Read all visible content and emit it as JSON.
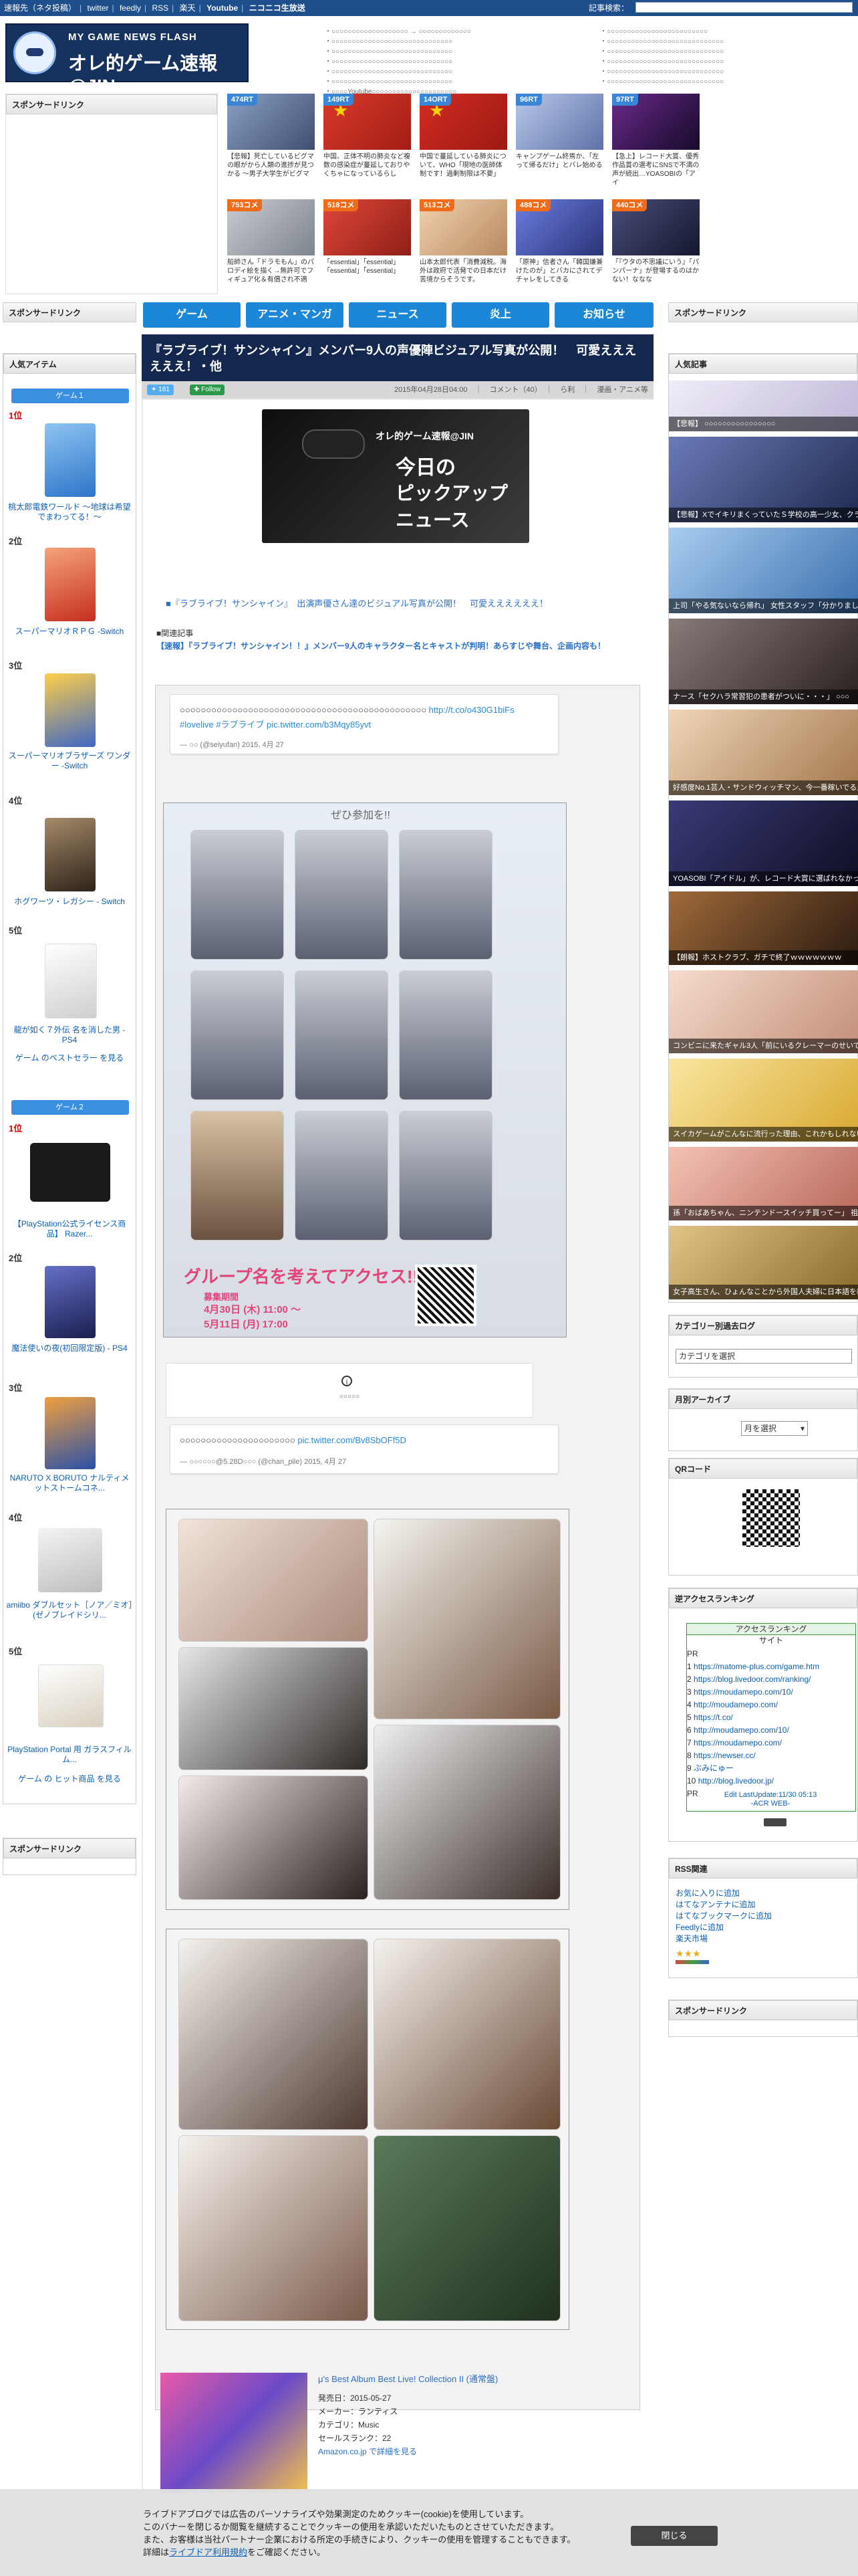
{
  "topbar": {
    "links": [
      "速報先（ネタ投稿）",
      "twitter",
      "feedly",
      "RSS",
      "楽天",
      "Youtube",
      "ニコニコ生放送"
    ],
    "search_label": "記事検索：",
    "search_placeholder": ""
  },
  "header": {
    "logo_subtitle": "MY GAME NEWS FLASH",
    "logo_title": "オレ的ゲーム速報@JIN",
    "links_col1": [
      "・○○○○○○○○○○○○○○○○○○○ → ○○○○○○○○○○○○○",
      "・○○○○○○○○○○○○○○○○○○○○○○○○○○○○○○",
      "・○○○○○○○○○○○○○○○○○○○○○○○○○○○○○○",
      "・○○○○○○○○○○○○○○○○○○○○○○○○○○○○○○",
      "・○○○○○○○○○○○○○○○○○○○○○○○○○○○○○○",
      "・○○○○○○○○○○○○○○○○○○○○○○○○○○○○○○",
      "・○○○○Youtube○○○○○○○○○○○○○○○○○○○○○"
    ],
    "links_col2": [
      "・○○○○○○○○○○○○○○○○○○○○○○○○○",
      "・○○○○○○○○○○○○○○○○○○○○○○○○○○○○○",
      "・○○○○○○○○○○○○○○○○○○○○○○○○○○○○○",
      "・○○○○○○○○○○○○○○○○○○○○○○○○○○○○○",
      "・○○○○○○○○○○○○○○○○○○○○○○○○○○○○○",
      "・○○○○○○○○○○○○○○○○○○○○○○○○○○○○○"
    ]
  },
  "sponsored_label": "スポンサードリンク",
  "thumbs": [
    {
      "badge": "474RT",
      "badge_type": "blue",
      "caption": "【悲報】死亡しているビグマの眼がから人類の進捗が見つかる ～男子大学生がビグマ",
      "color": "#5a6d8e"
    },
    {
      "badge": "149RT",
      "badge_type": "blue",
      "caption": "中国、正体不明の肺炎など複数の感染症が蔓延しておりやくちゃになっているらし",
      "color": "#c42a1f"
    },
    {
      "badge": "14ORT",
      "badge_type": "blue",
      "caption": "中国で蔓延している肺炎について、WHO「現地の医師体制です！過剰制限は不要」",
      "color": "#b8241c"
    },
    {
      "badge": "96RT",
      "badge_type": "blue",
      "caption": "キャンプゲーム終焉か、「左って帰るだけ」とバレ始める",
      "color": "#7d8fb8"
    },
    {
      "badge": "97RT",
      "badge_type": "blue",
      "caption": "【急上】レコード大賞、優秀作品賞の選考にSNSで不満の声が続出…YOASOBIの「アイ",
      "color": "#2a1640"
    },
    {
      "badge": "753コメ",
      "badge_type": "orange",
      "caption": "船師さん「ドラモもん」のパロディ絵を描く→無許可でフィギュア化＆有償され不適",
      "color": "#9aa0a8"
    },
    {
      "badge": "518コメ",
      "badge_type": "orange",
      "caption": "「essential」「essential」「essential」「essential」",
      "color": "#c23328"
    },
    {
      "badge": "513コメ",
      "badge_type": "orange",
      "caption": "山本太郎代表「消費減税。海外は政府で活発での日本だけ苦境からそうです。",
      "color": "#d8b38a"
    },
    {
      "badge": "488コメ",
      "badge_type": "orange",
      "caption": "「原神」信者さん「韓国嫌兼けたのが」とバカにされてデチャレをしてきる",
      "color": "#3a4b9e"
    },
    {
      "badge": "440コメ",
      "badge_type": "orange",
      "caption": "「『ウタの不思議にいう』「パンパーナ」が登場するのはかない！ななな",
      "color": "#2b2d4e"
    }
  ],
  "nav": [
    "ゲーム",
    "アニメ・マンガ",
    "ニュース",
    "炎上",
    "お知らせ"
  ],
  "left_sidebar": {
    "popular_title": "人気アイテム",
    "game_tab1": "ゲーム１",
    "rank_list1": [
      {
        "rank": "1位",
        "name": "桃太郎電鉄ワールド ～地球は希望でまわってる！～",
        "red": true,
        "color": "#3e8ed8"
      },
      {
        "rank": "2位",
        "name": "スーパーマリオＲＰＧ -Switch",
        "red": false,
        "color": "#d6483b"
      },
      {
        "rank": "3位",
        "name": "スーパーマリオブラザーズ ワンダー -Switch",
        "red": false,
        "color": "#4b6fbf"
      },
      {
        "rank": "4位",
        "name": "ホグワーツ・レガシー - Switch",
        "red": false,
        "color": "#4d3b2a"
      },
      {
        "rank": "5位",
        "name": "龍が如く７外伝 名を消した男 - PS4",
        "red": false,
        "color": "#f3f3f3"
      }
    ],
    "best_link1": "ゲーム のベストセラー を見る",
    "game_tab2": "ゲーム２",
    "rank_list2": [
      {
        "rank": "1位",
        "name": "【PlayStation公式ライセンス商品】 Razer...",
        "red": true,
        "color": "#1a1a1a"
      },
      {
        "rank": "2位",
        "name": "魔法使いの夜(初回限定版) - PS4",
        "red": false,
        "color": "#2f3a7a"
      },
      {
        "rank": "3位",
        "name": "NARUTO X BORUTO ナルティメットストームコネ...",
        "red": false,
        "color": "#d5682c"
      },
      {
        "rank": "4位",
        "name": "amiibo ダブルセット［ノア／ミオ］(ゼノブレイドシリ...",
        "red": false,
        "color": "#d7d7d7"
      },
      {
        "rank": "5位",
        "name": "PlayStation Portal 用 ガラスフィルム...",
        "red": false,
        "color": "#f0f0f0"
      }
    ],
    "best_link2": "ゲーム の ヒット商品 を見る",
    "sponsor_bottom": "スポンサードリンク"
  },
  "article": {
    "title": "『ラブライブ！サンシャイン』メンバー9人の声優陣ビジュアル写真が公開！　可愛ええええええ！・他",
    "tweet_count": "181",
    "follow_label": "Follow",
    "meta": "2015年04月28日04:00　｜　コメント（40）　｜　ら利　｜　漫画・アニメ等",
    "banner_line1": "オレ的ゲーム速報@JIN",
    "banner_line2": "今日の",
    "banner_line3": "ピックアップ",
    "banner_line4": "ニュース",
    "headline_link": "■『ラブライブ！サンシャイン』　出演声優さん達のビジュアル写真が公開！　可愛ええええええ！",
    "related_label": "■関連記事",
    "related_link": "【速報】『ラブライブ！サンシャイン！！』メンバー9人のキャラクター名とキャストが判明！あらすじや舞台、企画内容も！",
    "tweet1_text": "○○○○○○○○○○○○○○○○○○○○○○○○○○○○○○○○○○○○○○○○○○○○○○○",
    "tweet1_link": "http://t.co/o430G1biFs #lovelive #ラブライブ pic.twitter.com/b3Mqy85yvt",
    "tweet1_meta": "— ○○ (@seiyufan) 2015, 4月 27",
    "poster_caption": "グループ名を考えてアクセス!!",
    "poster_sub1": "募集期間",
    "poster_sub2": "4月30日 (木) 11:00 ～",
    "poster_sub3": "5月11日 (月) 17:00",
    "poster_header": "ぜひ参加を!!",
    "media_unavailable": "○○○○○",
    "tweet2_text": "○○○○○○○○○○○○○○○○○○○○○○",
    "tweet2_link": "pic.twitter.com/Bv8SbOFf5D",
    "tweet2_meta": "— ○○○○○○@5.28D○○○ (@chan_pile) 2015, 4月 27",
    "album_title": "μ's Best Album Best Live! Collection II (通常盤)",
    "album_release": "発売日：2015-05-27",
    "album_maker": "メーカー：ランティス",
    "album_category": "カテゴリ：Music",
    "album_rank": "セールスランク：22",
    "album_link": "Amazon.co.jp で詳細を見る"
  },
  "right_sidebar": {
    "sponsor1": "スポンサードリンク",
    "popular_title": "人気記事",
    "popular": [
      {
        "caption": "【悲報】 ○○○○○○○○○○○○○○○○",
        "color": "#e8e4f2"
      },
      {
        "caption": "【悲報】XでイキリまくっていたＳ学校の高一少女、クラスLINEにツイートを晒されて厳しい状態に",
        "color": "#3f4c7e"
      },
      {
        "caption": "上司「やる気ないなら帰れ」 女性スタッフ「分かりました、辞めます」→ 結果ｗｗｗｗｗｗ",
        "color": "#7aa6d3"
      },
      {
        "caption": "ナース「セクハラ常習犯の患者がついに・・・」 ○○○",
        "color": "#4a3e3a"
      },
      {
        "caption": "好感度No.1芸人・サンドウィッチマン、今一番稼いでる人ばかりまくりの素をした",
        "color": "#c9a07c"
      },
      {
        "caption": "YOASOBI「アイドル」が、レコード大賞に選ばれなかった理由、これかもしれない",
        "color": "#1c1c3a"
      },
      {
        "caption": "【朗報】ホストクラブ、ガチで終了ｗｗｗｗｗｗｗ",
        "color": "#5a3a2a"
      },
      {
        "caption": "コンビニに来たギャル3人「前にいるクレーマーのせいで入らざる」ちょうどそこに…",
        "color": "#e2b9a4"
      },
      {
        "caption": "スイカゲームがこんなに流行った理由、これかもしれない",
        "color": "#f2d35a"
      },
      {
        "caption": "孫「おばあちゃん、ニンテンドースイッチ買ってー」 祖母「いいよ」 → 結果",
        "color": "#e09a8a"
      },
      {
        "caption": "女子高生さん、ひょんなことから外国人夫婦に日本語を教える事になってしまった結果",
        "color": "#b5944c"
      }
    ],
    "category_title": "カテゴリー別過去ログ",
    "category_select": "カテゴリを選択",
    "archive_title": "月別アーカイブ",
    "archive_select": "月を選択",
    "qr_title": "QRコード",
    "access_title": "逆アクセスランキング",
    "access_header": "アクセスランキング",
    "access_col": "サイト",
    "access_rows": [
      {
        "n": "PR",
        "site": ""
      },
      {
        "n": "1",
        "site": "https://matome-plus.com/game.htm"
      },
      {
        "n": "2",
        "site": "https://blog.livedoor.com/ranking/"
      },
      {
        "n": "3",
        "site": "https://moudamepo.com/10/"
      },
      {
        "n": "4",
        "site": "http://moudamepo.com/"
      },
      {
        "n": "5",
        "site": "https://t.co/"
      },
      {
        "n": "6",
        "site": "http://moudamepo.com/10/"
      },
      {
        "n": "7",
        "site": "https://moudamepo.com/"
      },
      {
        "n": "8",
        "site": "https://newser.cc/"
      },
      {
        "n": "9",
        "site": "ぶみにゅー"
      },
      {
        "n": "10",
        "site": "http://blog.livedoor.jp/"
      },
      {
        "n": "PR",
        "site": ""
      }
    ],
    "access_footer": "Edit LastUpdate:11/30 05:13",
    "access_footer2": "-ACR WEB-",
    "rss_title": "RSS関連",
    "rss_links": [
      "お気に入りに追加",
      "はてなアンテナに追加",
      "はてなブックマークに追加",
      "Feedlyに追加",
      "楽天市場"
    ],
    "sponsor2": "スポンサードリンク"
  },
  "cookie": {
    "line1": "ライブドアブログでは広告のパーソナライズや効果測定のためクッキー(cookie)を使用しています。",
    "line2": "このバナーを閉じるか閲覧を継続することでクッキーの使用を承認いただいたものとさせていただきます。",
    "line3": "また、お客様は当社パートナー企業における所定の手続きにより、クッキーの使用を管理することもできます。",
    "line4_pre": "詳細は",
    "line4_link": "ライブドア利用規約",
    "line4_post": "をご確認ください。",
    "close": "閉じる"
  }
}
